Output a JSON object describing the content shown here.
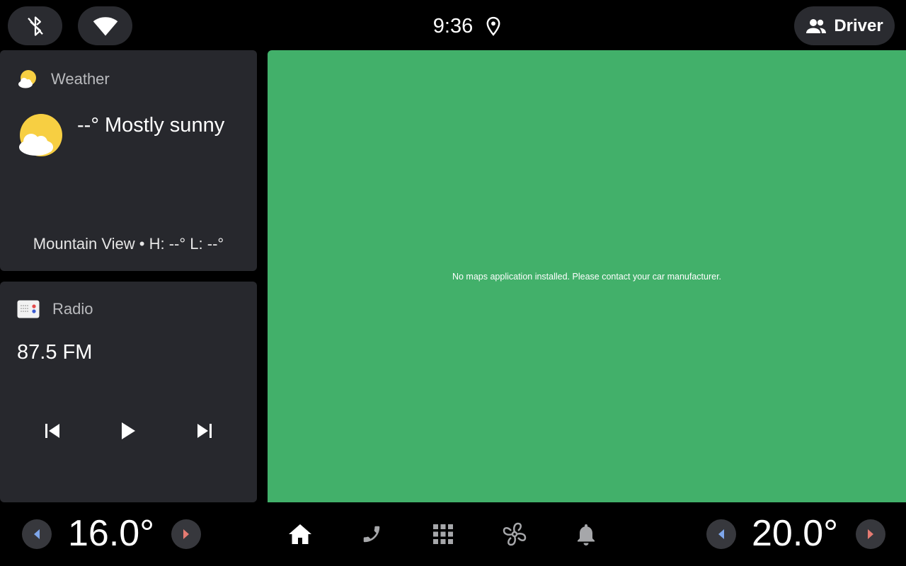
{
  "status_bar": {
    "time": "9:36",
    "user_label": "Driver",
    "icons": [
      "bluetooth-off-icon",
      "wifi-icon",
      "location-icon",
      "people-icon"
    ]
  },
  "weather": {
    "title": "Weather",
    "condition": "--° Mostly sunny",
    "footer": "Mountain View • H: --° L: --°",
    "icon": "partly-sunny-icon"
  },
  "radio": {
    "title": "Radio",
    "frequency": "87.5 FM",
    "controls": [
      "skip-previous-icon",
      "play-icon",
      "skip-next-icon"
    ]
  },
  "map": {
    "message": "No maps application installed. Please contact your car manufacturer.",
    "background_color": "#42b06a"
  },
  "climate": {
    "left_temp": "16.0°",
    "right_temp": "20.0°",
    "down_color": "#7ea6ea",
    "up_color": "#e57b72"
  },
  "nav": [
    "home-icon",
    "phone-icon",
    "apps-grid-icon",
    "fan-icon",
    "bell-icon"
  ]
}
